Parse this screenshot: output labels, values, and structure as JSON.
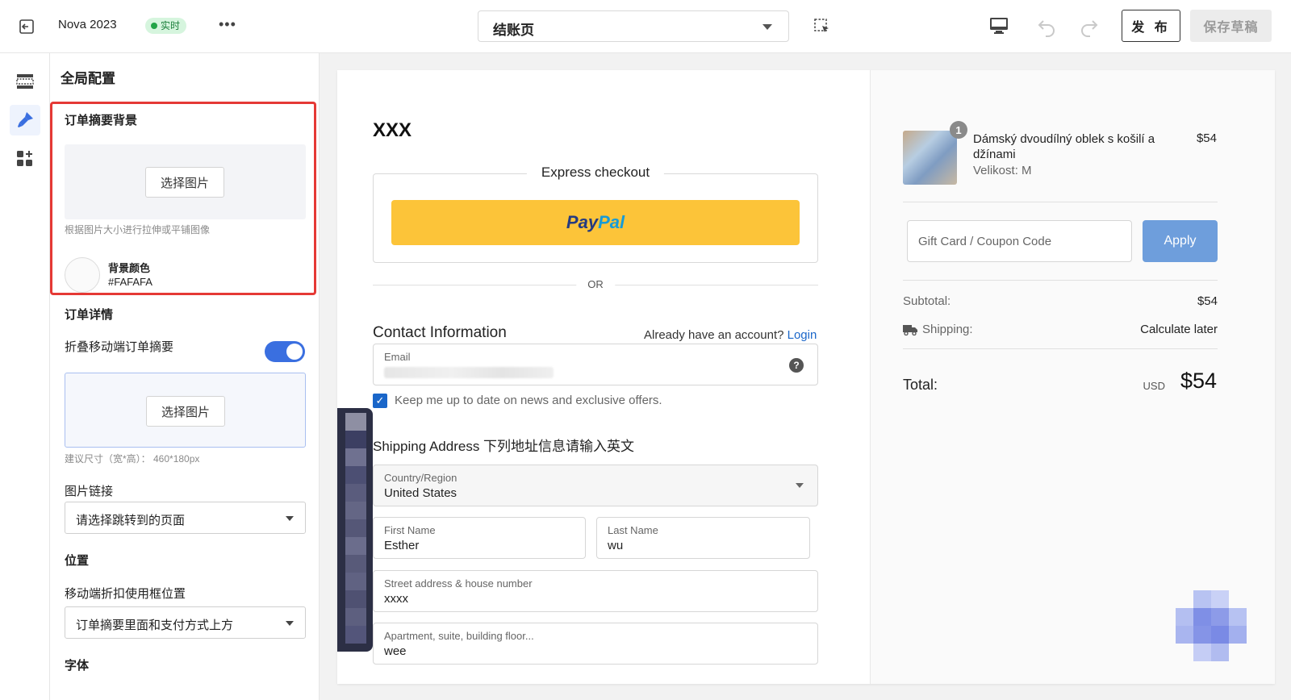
{
  "topbar": {
    "store_name": "Nova 2023",
    "live_badge": "实时",
    "more_label": "•••",
    "page_select": "结账页",
    "publish_label": "发 布",
    "save_draft_label": "保存草稿",
    "icons": [
      "exit-icon",
      "more-icon",
      "selection-tool-icon",
      "desktop-icon",
      "undo-icon",
      "redo-icon"
    ]
  },
  "rail": {
    "items": [
      "layout-icon",
      "theme-brush-icon",
      "add-widget-icon"
    ],
    "accent": "#3a6fe0"
  },
  "panel": {
    "title": "全局配置",
    "summary_bg": {
      "label": "订单摘要背景",
      "choose_image": "选择图片",
      "hint": "根据图片大小进行拉伸或平铺图像",
      "color_label": "背景颜色",
      "color_value": "#FAFAFA"
    },
    "order_details": {
      "label": "订单详情",
      "collapse_mobile": "折叠移动端订单摘要",
      "collapse_on": true,
      "choose_image": "选择图片",
      "size_hint": "建议尺寸（宽*高）：  460*180px",
      "image_link_label": "图片链接",
      "image_link_value": "请选择跳转到的页面"
    },
    "position": {
      "label": "位置",
      "mobile_discount_label": "移动端折扣使用框位置",
      "mobile_discount_value": "订单摘要里面和支付方式上方"
    },
    "font_label": "字体"
  },
  "checkout": {
    "shop_name": "XXX",
    "express_title": "Express checkout",
    "paypal": {
      "pay": "Pay",
      "pal": "Pal"
    },
    "or": "OR",
    "contact_title": "Contact Information",
    "have_account": "Already have an account?",
    "login": "Login",
    "email_label": "Email",
    "help": "?",
    "newsletter": "Keep me up to date on news and exclusive offers.",
    "shipping_title": "Shipping Address 下列地址信息请输入英文",
    "country_label": "Country/Region",
    "country_value": "United States",
    "first_name_label": "First Name",
    "first_name_value": "Esther",
    "last_name_label": "Last Name",
    "last_name_value": "wu",
    "street_label": "Street address & house number",
    "street_value": "xxxx",
    "apt_label": "Apartment, suite, building floor...",
    "apt_value": "wee"
  },
  "summary": {
    "product": {
      "qty": "1",
      "name": "Dámský dvoudílný oblek s košilí a džínami",
      "variant": "Velikost: M",
      "price": "$54"
    },
    "coupon_placeholder": "Gift Card / Coupon Code",
    "apply": "Apply",
    "subtotal_label": "Subtotal:",
    "subtotal_value": "$54",
    "shipping_label": "Shipping:",
    "shipping_value": "Calculate later",
    "total_label": "Total:",
    "currency": "USD",
    "total_value": "$54"
  }
}
